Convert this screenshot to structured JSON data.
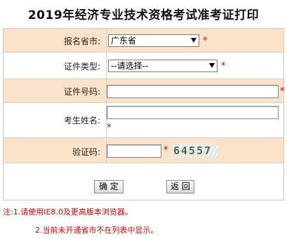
{
  "page": {
    "title": "2019年经济专业技术资格考试准考证打印"
  },
  "form": {
    "province": {
      "label": "报名省市:",
      "selected": "广东省"
    },
    "id_type": {
      "label": "证件类型:",
      "selected": "--请选择--"
    },
    "id_number": {
      "label": "证件号码:",
      "value": ""
    },
    "name": {
      "label": "考生姓名:",
      "value": ""
    },
    "captcha": {
      "label": "验证码:",
      "value": "",
      "image_text": "64557"
    },
    "required_mark": "*"
  },
  "buttons": {
    "confirm": "确 定",
    "back": "返 回"
  },
  "notes": {
    "line1": "注:1.请使用IE8.0及更高版本浏览器。",
    "line2": "2.当前未开通省市不在列表中显示。"
  },
  "colors": {
    "row_shade": "#fbe3c9",
    "required": "#e00000"
  }
}
